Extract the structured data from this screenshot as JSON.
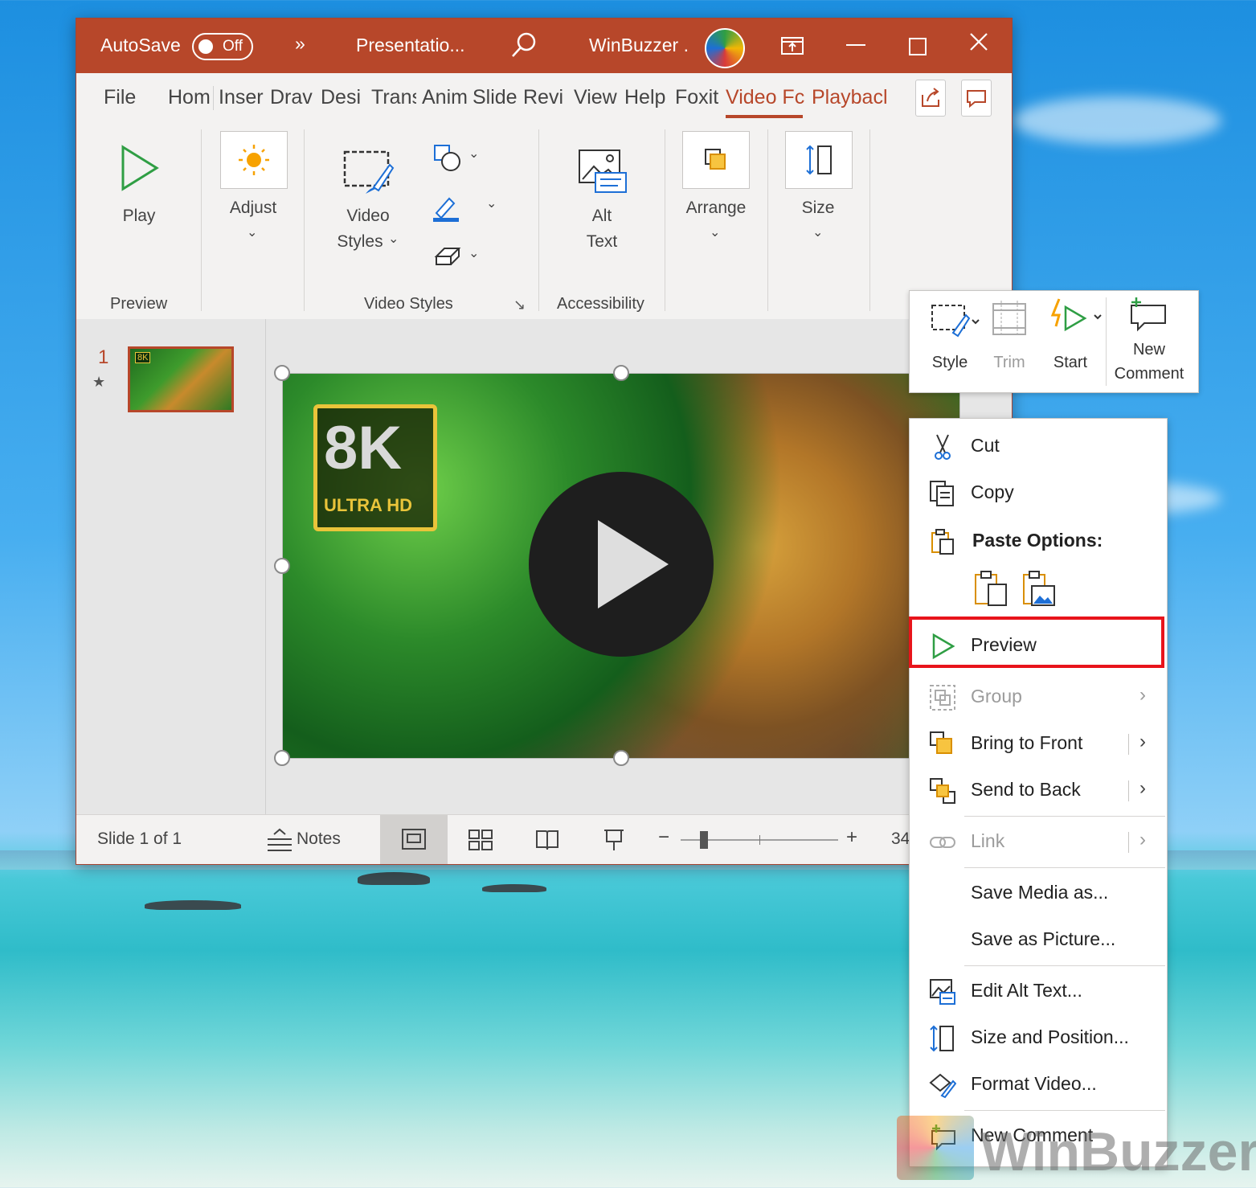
{
  "window": {
    "autosave_label": "AutoSave",
    "autosave_state": "Off",
    "overflow": "»",
    "doc_title": "Presentatio...",
    "user_name": "WinBuzzer .",
    "accent": "#b7472a"
  },
  "tabs": [
    "File",
    "Hom",
    "Inser",
    "Drav",
    "Desi",
    "Trans",
    "Anim",
    "Slide",
    "Revi",
    "View",
    "Help",
    "Foxit",
    "Video Fc",
    "Playbacl"
  ],
  "active_tab": "Video Fc",
  "ribbon": {
    "play": "Play",
    "adjust": "Adjust",
    "video_styles_1": "Video",
    "video_styles_2": "Styles",
    "alt_1": "Alt",
    "alt_2": "Text",
    "arrange": "Arrange",
    "size": "Size",
    "group_preview": "Preview",
    "group_video_styles": "Video Styles",
    "group_accessibility": "Accessibility"
  },
  "slides": {
    "number": "1"
  },
  "video": {
    "badge_big": "8K",
    "badge_small": "ULTRA HD"
  },
  "status": {
    "slide_info": "Slide 1 of 1",
    "notes": "Notes",
    "zoom": "34",
    "zoom_fraction": 0.15
  },
  "mini_toolbar": {
    "style": "Style",
    "trim": "Trim",
    "start": "Start",
    "new_1": "New",
    "new_2": "Comment"
  },
  "context_menu": {
    "cut": "Cut",
    "copy": "Copy",
    "paste_options": "Paste Options:",
    "preview": "Preview",
    "group": "Group",
    "bring_front": "Bring to Front",
    "send_back": "Send to Back",
    "link": "Link",
    "save_media": "Save Media as...",
    "save_picture": "Save as Picture...",
    "edit_alt": "Edit Alt Text...",
    "size_pos": "Size and Position...",
    "format_video": "Format Video...",
    "new_comment": "New Comment",
    "highlight_color": "#e8141b"
  },
  "watermark": "WinBuzzer"
}
